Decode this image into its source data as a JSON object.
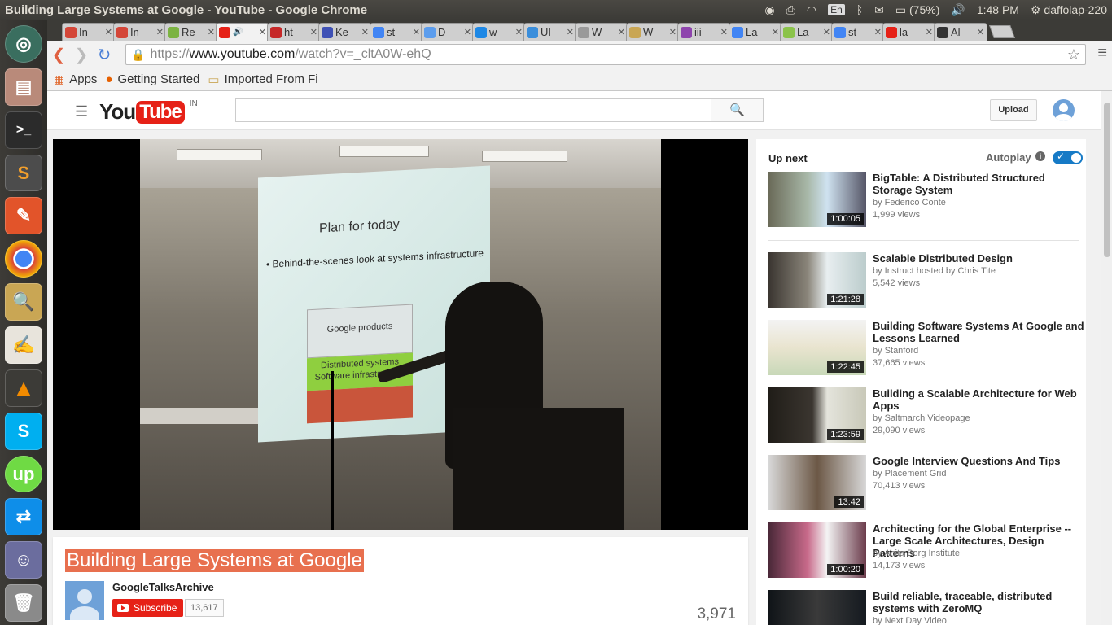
{
  "topbar": {
    "title": "Building Large Systems at Google - YouTube - Google Chrome",
    "keyboard": "En",
    "battery": "(75%)",
    "time": "1:48 PM",
    "user": "daffolap-220"
  },
  "launcher": {
    "icons": [
      "ubuntu-dash-icon",
      "files-icon",
      "terminal-icon",
      "sublime-text-icon",
      "paint-icon",
      "chrome-icon",
      "search-app-icon",
      "text-editor-icon",
      "vlc-icon",
      "skype-icon",
      "upwork-icon",
      "teamviewer-icon",
      "pidgin-icon",
      "trash-icon"
    ]
  },
  "tabs": [
    {
      "label": "In",
      "color": "#d44638"
    },
    {
      "label": "In",
      "color": "#d44638"
    },
    {
      "label": "Re",
      "color": "#7cb342"
    },
    {
      "label": "",
      "color": "#e62117",
      "active": true
    },
    {
      "label": "ht",
      "color": "#c62828"
    },
    {
      "label": "Ke",
      "color": "#3f51b5"
    },
    {
      "label": "st",
      "color": "#4285f4"
    },
    {
      "label": "D",
      "color": "#5c9ded"
    },
    {
      "label": "w",
      "color": "#1e88e5"
    },
    {
      "label": "UI",
      "color": "#3b8edb"
    },
    {
      "label": "W",
      "color": "#999999"
    },
    {
      "label": "W",
      "color": "#c9a654"
    },
    {
      "label": "iii",
      "color": "#8e44ad"
    },
    {
      "label": "La",
      "color": "#4285f4"
    },
    {
      "label": "La",
      "color": "#8bc34a"
    },
    {
      "label": "st",
      "color": "#4285f4"
    },
    {
      "label": "la",
      "color": "#e62117"
    },
    {
      "label": "Al",
      "color": "#333333"
    }
  ],
  "omnibar": {
    "scheme": "https://",
    "host": "www.youtube.com",
    "path": "/watch?v=_cltA0W-ehQ"
  },
  "bookmarks": [
    {
      "label": "Apps",
      "icon": "apps-grid-icon"
    },
    {
      "label": "Getting Started",
      "icon": "firefox-icon"
    },
    {
      "label": "Imported From Fi",
      "icon": "folder-icon"
    }
  ],
  "youtube": {
    "logo_you": "You",
    "logo_tube": "Tube",
    "region": "IN",
    "search_placeholder": "",
    "upload_label": "Upload"
  },
  "slide": {
    "title": "Plan for today",
    "bullet": "• Behind-the-scenes look at systems infrastructure",
    "box1": "Google products",
    "box2": "Distributed systems Software infrastructure"
  },
  "video": {
    "title": "Building Large Systems at Google",
    "channel": "GoogleTalksArchive",
    "subscribe_label": "Subscribe",
    "subscriber_count": "13,617",
    "views": "3,971"
  },
  "sidebar": {
    "up_next": "Up next",
    "autoplay": "Autoplay",
    "autoplay_on": true,
    "videos": [
      {
        "title": "BigTable: A Distributed Structured Storage System",
        "by": "by Federico Conte",
        "views": "1,999 views",
        "duration": "1:00:05"
      },
      {
        "title": "Scalable Distributed Design",
        "by": "by Instruct hosted by Chris Tite",
        "views": "5,542 views",
        "duration": "1:21:28"
      },
      {
        "title": "Building Software Systems At Google and Lessons Learned",
        "by": "by Stanford",
        "views": "37,665 views",
        "duration": "1:22:45"
      },
      {
        "title": "Building a Scalable Architecture for Web Apps",
        "by": "by Saltmarch Videopage",
        "views": "29,090 views",
        "duration": "1:23:59"
      },
      {
        "title": "Google Interview Questions And Tips",
        "by": "by Placement Grid",
        "views": "70,413 views",
        "duration": "13:42"
      },
      {
        "title": "Architecting for the Global Enterprise -- Large Scale Architectures, Design Patterns",
        "by": "by Anita Borg Institute",
        "views": "14,173 views",
        "duration": "1:00:20"
      },
      {
        "title": "Build reliable, traceable, distributed systems with ZeroMQ",
        "by": "by Next Day Video",
        "views": "",
        "duration": ""
      }
    ]
  },
  "colors": {
    "youtube_red": "#e62117",
    "title_highlight": "#e8704f",
    "autoplay_blue": "#167ac6"
  }
}
